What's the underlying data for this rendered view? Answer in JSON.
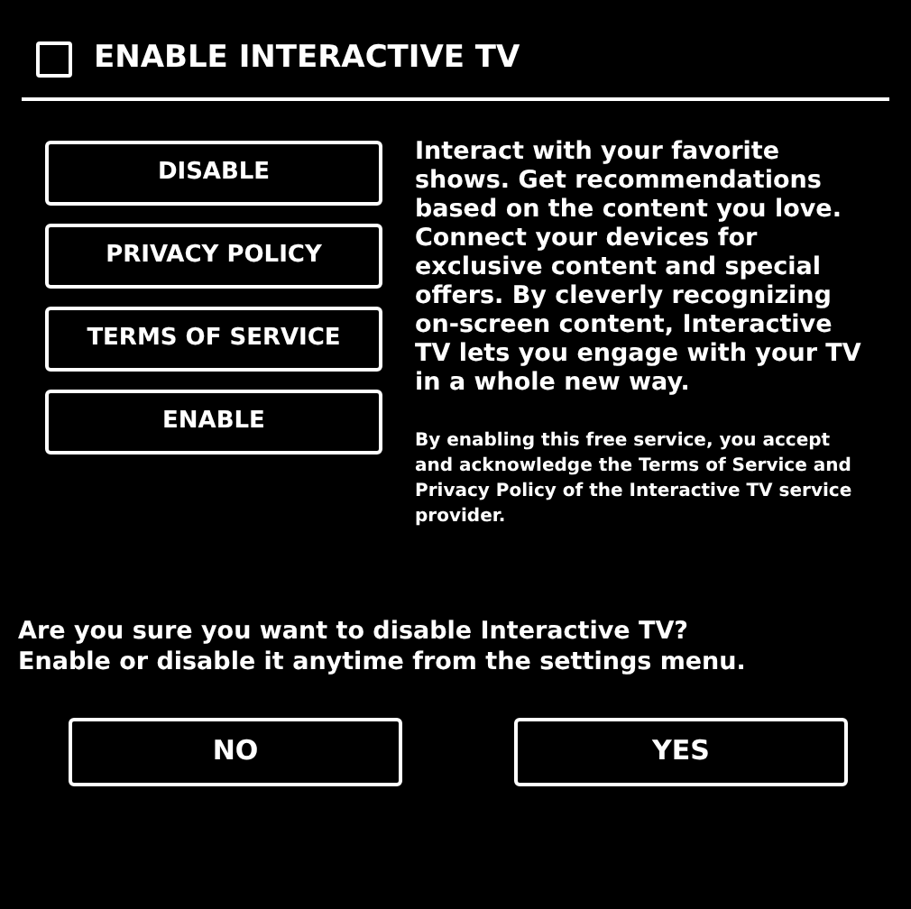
{
  "header": {
    "title": "ENABLE INTERACTIVE TV",
    "checked": false
  },
  "menu_buttons": [
    "DISABLE",
    "PRIVACY POLICY",
    "TERMS OF SERVICE",
    "ENABLE"
  ],
  "description": "Interact with your favorite shows. Get recommendations based on the content you love. Connect your devices for exclusive content and special offers. By cleverly recognizing on-screen content, Interactive TV lets you engage with your TV in a whole new way.",
  "disclaimer": "By enabling this free service, you accept and acknowledge the Terms of Service and Privacy Policy of the Interactive TV service provider.",
  "prompt": [
    "Are you sure you want to disable Interactive TV?",
    "Enable or disable it anytime from the settings menu."
  ],
  "dialog_buttons": [
    "NO",
    "YES"
  ]
}
